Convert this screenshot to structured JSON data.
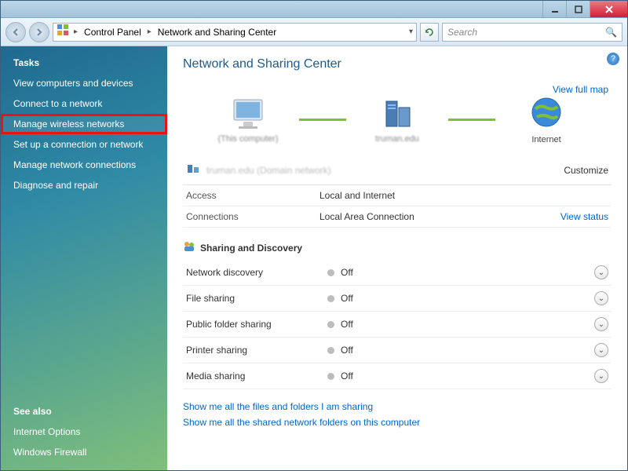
{
  "titlebar": {},
  "toolbar": {
    "breadcrumb": {
      "root_icon": "control-panel",
      "seg1": "Control Panel",
      "seg2": "Network and Sharing Center"
    },
    "search_placeholder": "Search"
  },
  "sidebar": {
    "tasks_header": "Tasks",
    "tasks": [
      "View computers and devices",
      "Connect to a network",
      "Manage wireless networks",
      "Set up a connection or network",
      "Manage network connections",
      "Diagnose and repair"
    ],
    "highlight_index": 2,
    "see_also_header": "See also",
    "see_also": [
      "Internet Options",
      "Windows Firewall"
    ]
  },
  "content": {
    "title": "Network and Sharing Center",
    "view_full_map": "View full map",
    "map": {
      "node1_label": "(This computer)",
      "node2_label": "truman.edu",
      "node3_label": "Internet"
    },
    "network_name_blur": "truman.edu (Domain network)",
    "customize": "Customize",
    "rows": [
      {
        "k": "Access",
        "v": "Local and Internet",
        "link": ""
      },
      {
        "k": "Connections",
        "v": "Local Area Connection",
        "link": "View status"
      }
    ],
    "sharing_header": "Sharing and Discovery",
    "sharing": [
      {
        "k": "Network discovery",
        "v": "Off"
      },
      {
        "k": "File sharing",
        "v": "Off"
      },
      {
        "k": "Public folder sharing",
        "v": "Off"
      },
      {
        "k": "Printer sharing",
        "v": "Off"
      },
      {
        "k": "Media sharing",
        "v": "Off"
      }
    ],
    "bottom_links": [
      "Show me all the files and folders I am sharing",
      "Show me all the shared network folders on this computer"
    ]
  }
}
